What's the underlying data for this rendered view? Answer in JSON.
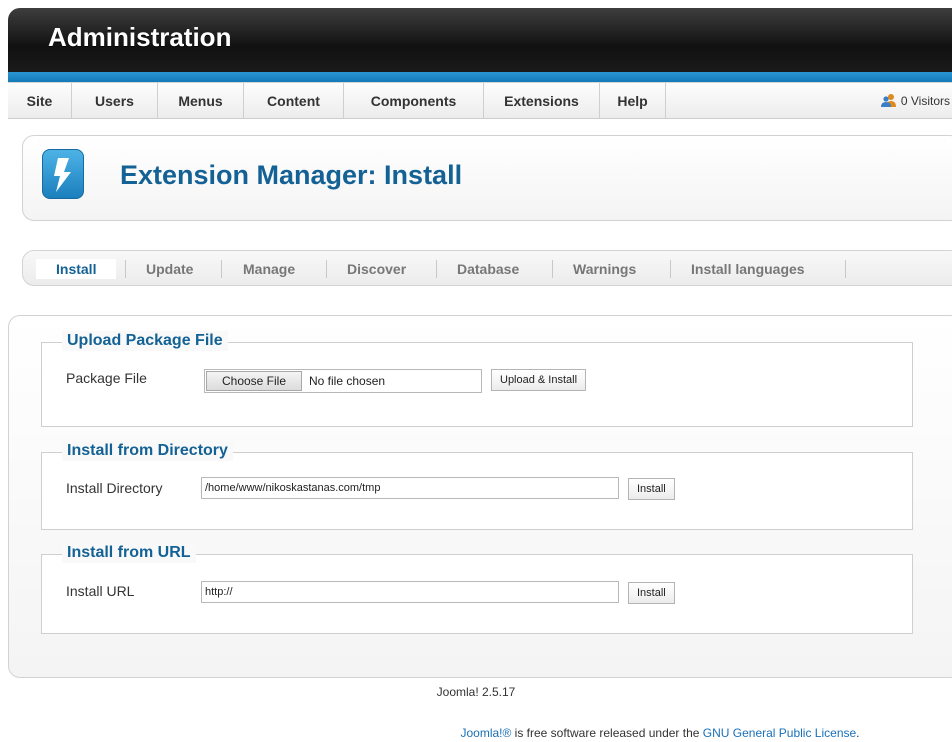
{
  "header": {
    "title": "Administration"
  },
  "menu": {
    "items": [
      {
        "label": "Site"
      },
      {
        "label": "Users"
      },
      {
        "label": "Menus"
      },
      {
        "label": "Content"
      },
      {
        "label": "Components"
      },
      {
        "label": "Extensions"
      },
      {
        "label": "Help"
      }
    ],
    "visitors": "0 Visitors"
  },
  "page": {
    "title": "Extension Manager: Install"
  },
  "submenu": {
    "items": [
      {
        "label": "Install",
        "active": true
      },
      {
        "label": "Update"
      },
      {
        "label": "Manage"
      },
      {
        "label": "Discover"
      },
      {
        "label": "Database"
      },
      {
        "label": "Warnings"
      },
      {
        "label": "Install languages"
      }
    ]
  },
  "upload": {
    "legend": "Upload Package File",
    "label": "Package File",
    "choose_button": "Choose File",
    "file_status": "No file chosen",
    "submit": "Upload & Install"
  },
  "directory": {
    "legend": "Install from Directory",
    "label": "Install Directory",
    "value": "/home/www/nikoskastanas.com/tmp",
    "submit": "Install"
  },
  "url": {
    "legend": "Install from URL",
    "label": "Install URL",
    "value": "http://",
    "submit": "Install"
  },
  "footer": {
    "version": "Joomla! 2.5.17",
    "license_prefix": "Joomla!®",
    "license_middle": " is free software released under the ",
    "license_link": "GNU General Public License",
    "license_suffix": "."
  },
  "colors": {
    "accent": "#146295",
    "stripe": "#1e88c9"
  }
}
